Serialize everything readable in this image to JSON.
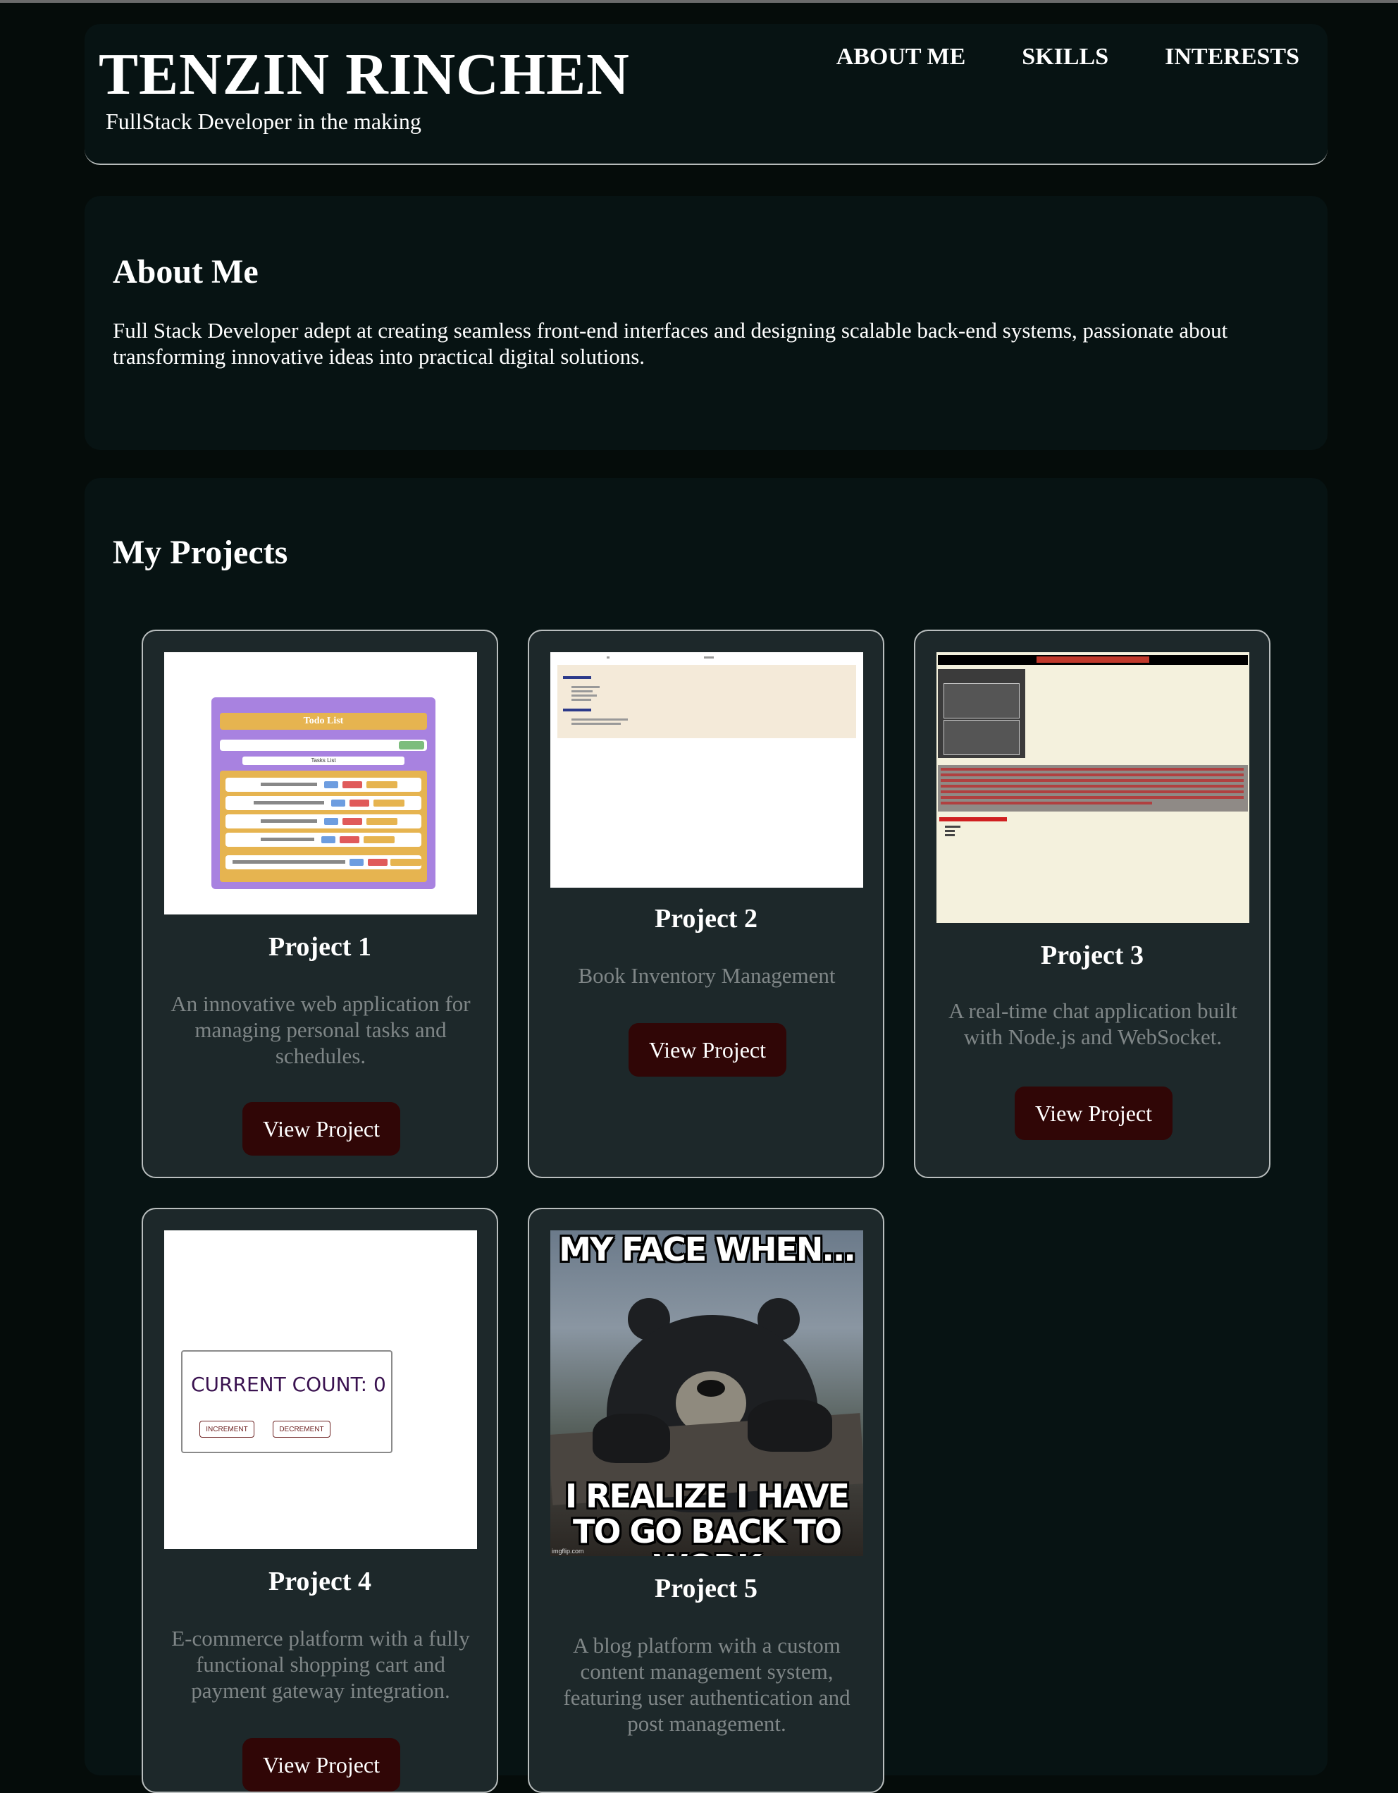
{
  "header": {
    "name": "TENZIN RINCHEN",
    "tagline": "FullStack Developer in the making",
    "nav": [
      "ABOUT ME",
      "SKILLS",
      "INTERESTS"
    ]
  },
  "about": {
    "title": "About Me",
    "text": "Full Stack Developer adept at creating seamless front-end interfaces and designing scalable back-end systems, passionate about transforming innovative ideas into practical digital solutions."
  },
  "projects": {
    "title": "My Projects",
    "button_label": "View Project",
    "items": [
      {
        "title": "Project 1",
        "description": "An innovative web application for managing personal tasks and schedules.",
        "thumb": {
          "heading": "Todo List",
          "list_heading": "Tasks List"
        }
      },
      {
        "title": "Project 2",
        "description": "Book Inventory Management"
      },
      {
        "title": "Project 3",
        "description": "A real-time chat application built with Node.js and WebSocket."
      },
      {
        "title": "Project 4",
        "description": "E-commerce platform with a fully functional shopping cart and payment gateway integration.",
        "thumb": {
          "count_text": "CURRENT COUNT: 0",
          "increment": "INCREMENT",
          "decrement": "DECREMENT"
        }
      },
      {
        "title": "Project 5",
        "description": "A blog platform with a custom content management system, featuring user authentication and post management.",
        "thumb": {
          "top_text": "MY FACE WHEN...",
          "bottom_text": "I REALIZE I HAVE TO GO BACK TO WORK",
          "watermark": "imgflip.com"
        }
      }
    ]
  },
  "colors": {
    "background": "#050c0a",
    "panel": "#071313",
    "card": "#1d282a",
    "button": "#300606",
    "muted_text": "#7f8687"
  }
}
